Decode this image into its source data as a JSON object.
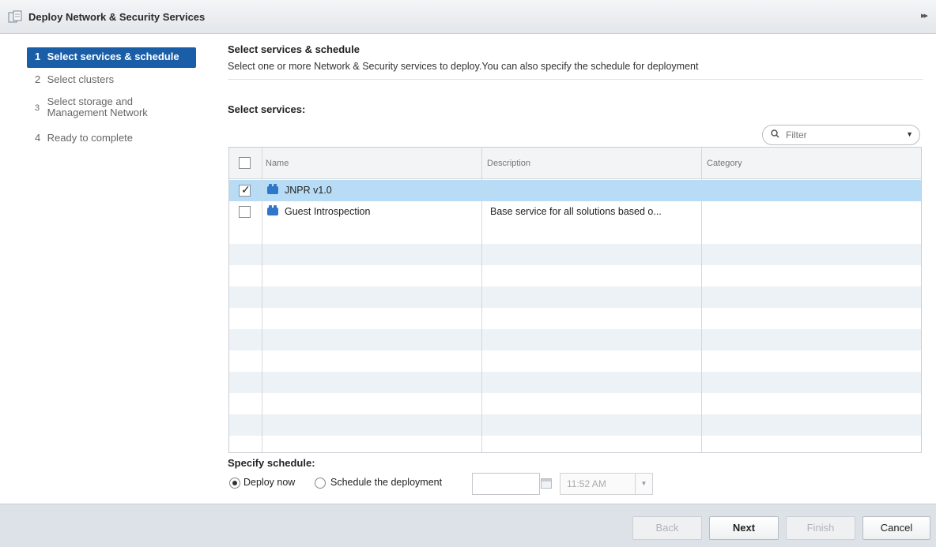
{
  "window": {
    "title": "Deploy Network & Security Services",
    "expand_glyph": "▸▸"
  },
  "nav": {
    "steps": [
      {
        "num": "1",
        "label": "Select services & schedule"
      },
      {
        "num": "2",
        "label": "Select clusters"
      },
      {
        "num": "3",
        "label_line1": "Select storage and",
        "label_line2": "Management Network"
      },
      {
        "num": "4",
        "label": "Ready to complete"
      }
    ]
  },
  "main": {
    "title": "Select services & schedule",
    "description": "Select one or more Network & Security services to deploy.You can also specify the schedule for deployment",
    "services_label": "Select services:",
    "filter_placeholder": "Filter",
    "columns": [
      "Name",
      "Description",
      "Category"
    ],
    "rows": [
      {
        "name": "JNPR v1.0",
        "description": "",
        "category": "",
        "checked": true
      },
      {
        "name": "Guest Introspection",
        "description": "Base service for all solutions based o...",
        "category": "",
        "checked": false
      }
    ],
    "schedule_label": "Specify schedule:",
    "deploy_now": "Deploy now",
    "schedule_deployment": "Schedule the deployment",
    "time_value": "11:52 AM"
  },
  "footer": {
    "back": "Back",
    "next": "Next",
    "finish": "Finish",
    "cancel": "Cancel"
  },
  "colors": {
    "active_step": "#1a5ea8",
    "selected_row": "#b8dcf5",
    "service_icon": "#2f77c9"
  }
}
